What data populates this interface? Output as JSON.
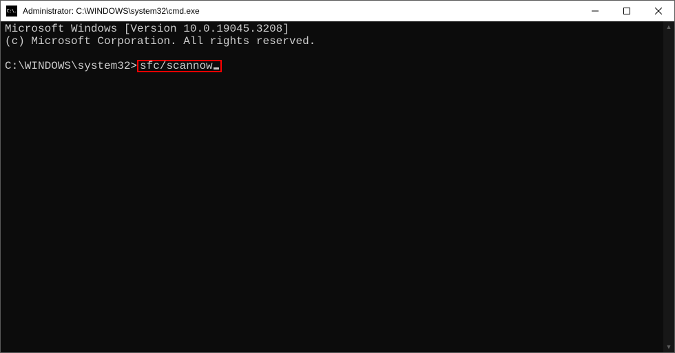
{
  "window": {
    "title": "Administrator: C:\\WINDOWS\\system32\\cmd.exe",
    "icon_text": "C:\\."
  },
  "console": {
    "line1": "Microsoft Windows [Version 10.0.19045.3208]",
    "line2": "(c) Microsoft Corporation. All rights reserved.",
    "prompt": "C:\\WINDOWS\\system32>",
    "command": "sfc/scannow"
  }
}
